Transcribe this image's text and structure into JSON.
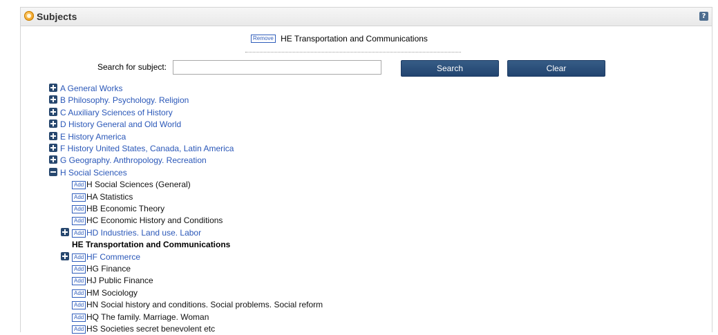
{
  "panel": {
    "title": "Subjects",
    "help": "?"
  },
  "selected": {
    "remove_label": "Remove",
    "subject": "HE Transportation and Communications"
  },
  "search": {
    "label": "Search for subject:",
    "value": "",
    "search_label": "Search",
    "clear_label": "Clear"
  },
  "top_level": [
    {
      "label": "A General Works",
      "expanded": false
    },
    {
      "label": "B Philosophy. Psychology. Religion",
      "expanded": false
    },
    {
      "label": "C Auxiliary Sciences of History",
      "expanded": false
    },
    {
      "label": "D History General and Old World",
      "expanded": false
    },
    {
      "label": "E History America",
      "expanded": false
    },
    {
      "label": "F History United States, Canada, Latin America",
      "expanded": false
    },
    {
      "label": "G Geography. Anthropology. Recreation",
      "expanded": false
    },
    {
      "label": "H Social Sciences",
      "expanded": true
    }
  ],
  "add_label": "Add",
  "h_children": [
    {
      "label": "H Social Sciences (General)",
      "has_children": false,
      "selected": false
    },
    {
      "label": "HA Statistics",
      "has_children": false,
      "selected": false
    },
    {
      "label": "HB Economic Theory",
      "has_children": false,
      "selected": false
    },
    {
      "label": "HC Economic History and Conditions",
      "has_children": false,
      "selected": false
    },
    {
      "label": "HD Industries. Land use. Labor",
      "has_children": true,
      "selected": false
    },
    {
      "label": "HE Transportation and Communications",
      "has_children": false,
      "selected": true
    },
    {
      "label": "HF Commerce",
      "has_children": true,
      "selected": false
    },
    {
      "label": "HG Finance",
      "has_children": false,
      "selected": false
    },
    {
      "label": "HJ Public Finance",
      "has_children": false,
      "selected": false
    },
    {
      "label": "HM Sociology",
      "has_children": false,
      "selected": false
    },
    {
      "label": "HN Social history and conditions. Social problems. Social reform",
      "has_children": false,
      "selected": false
    },
    {
      "label": "HQ The family. Marriage. Woman",
      "has_children": false,
      "selected": false
    },
    {
      "label": "HS Societies secret benevolent etc",
      "has_children": false,
      "selected": false
    }
  ]
}
